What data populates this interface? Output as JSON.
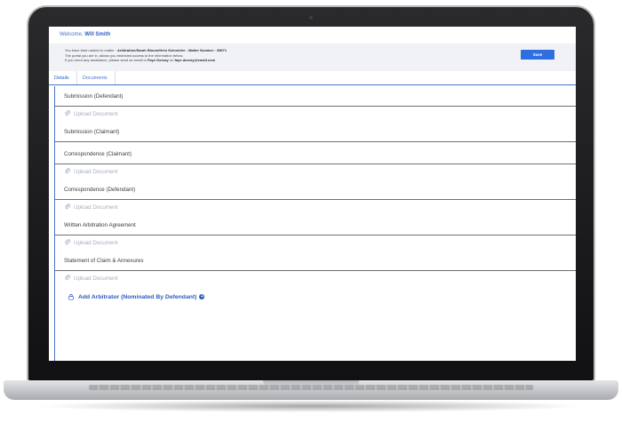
{
  "header": {
    "welcome_prefix": "Welcome,",
    "user_name": "Will Smith"
  },
  "notice": {
    "line1_prefix": "You have been added to matter :",
    "matter_parties": "Arbitration/Sarah Bloom/Hein Schneider",
    "matter_number": ": Matter Number : 39871",
    "line2": "The portal you are in, allows you restricted access to the information below.",
    "line3_prefix": "If you need any assistance, please send an email to",
    "contact_name": "Faye Doreay",
    "line3_mid": "on",
    "contact_email": "faye.doreay@email.com"
  },
  "toolbar": {
    "save_label": "Save"
  },
  "tabs": [
    {
      "label": "Details",
      "active": true
    },
    {
      "label": "Documents",
      "active": false
    }
  ],
  "sections": [
    {
      "title": "Submission (Defendant)",
      "upload_label": "Upload Document"
    },
    {
      "title": "Submission (Claimant)",
      "upload_label": ""
    },
    {
      "title": "Correspondence (Claimant)",
      "upload_label": "Upload Document"
    },
    {
      "title": "Correspondence (Defendant)",
      "upload_label": "Upload Document"
    },
    {
      "title": "Written Arbitration Agreement",
      "upload_label": "Upload Document"
    },
    {
      "title": "Statement of Claim & Annexures",
      "upload_label": "Upload Document"
    }
  ],
  "add_arbitrator": {
    "label": "Add Arbitrator (Nominated By Defendant)"
  },
  "colors": {
    "accent": "#2f6ee0",
    "link": "#2f5bbf",
    "muted_upload": "#a4aebf",
    "notice_bg": "#f1f2f6"
  },
  "icons": {
    "upload": "paperclip-icon",
    "arbitrator": "lock-icon",
    "add": "plus-circle-icon"
  }
}
